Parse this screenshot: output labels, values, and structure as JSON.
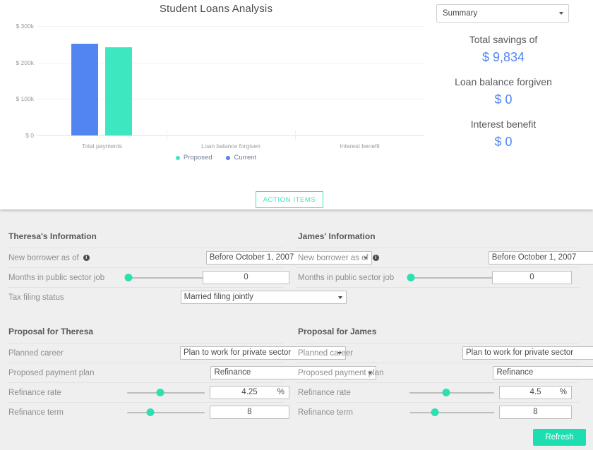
{
  "chart_data": {
    "type": "bar",
    "title": "Student Loans Analysis",
    "xlabel": "",
    "ylabel": "",
    "categories": [
      "Total payments",
      "Loan balance forgiven",
      "Interest benefit"
    ],
    "series": [
      {
        "name": "Proposed",
        "color": "#3de8c0",
        "values": [
          241000,
          0,
          0
        ]
      },
      {
        "name": "Current",
        "color": "#5285f2",
        "values": [
          251000,
          0,
          0
        ]
      }
    ],
    "ylim": [
      0,
      300000
    ],
    "yticks": [
      0,
      100000,
      200000,
      300000
    ],
    "ytick_labels": [
      "$ 0",
      "$ 100k",
      "$ 200k",
      "$ 300k"
    ],
    "grid": true,
    "legend_position": "bottom"
  },
  "summary": {
    "select_value": "Summary",
    "items": [
      {
        "label": "Total savings of",
        "value": "$ 9,834"
      },
      {
        "label": "Loan balance forgiven",
        "value": "$ 0"
      },
      {
        "label": "Interest benefit",
        "value": "$ 0"
      }
    ]
  },
  "action_items_label": "ACTION ITEMS",
  "refresh_label": "Refresh",
  "left": {
    "info_heading": "Theresa's Information",
    "proposal_heading": "Proposal for Theresa",
    "new_borrower_label": "New borrower as of",
    "new_borrower_value": "Before October 1, 2007",
    "months_label": "Months in public sector job",
    "months_value": "0",
    "months_slider_pct": 2,
    "tax_label": "Tax filing status",
    "tax_value": "Married filing jointly",
    "career_label": "Planned career",
    "career_value": "Plan to work for private sector",
    "plan_label": "Proposed payment plan",
    "plan_value": "Refinance",
    "rate_label": "Refinance rate",
    "rate_value": "4.25",
    "rate_unit": "%",
    "rate_slider_pct": 43,
    "term_label": "Refinance term",
    "term_value": "8",
    "term_slider_pct": 30
  },
  "right": {
    "info_heading": "James' Information",
    "proposal_heading": "Proposal for James",
    "new_borrower_label": "New borrower as of",
    "new_borrower_value": "Before October 1, 2007",
    "months_label": "Months in public sector job",
    "months_value": "0",
    "months_slider_pct": 2,
    "career_label": "Planned career",
    "career_value": "Plan to work for private sector",
    "plan_label": "Proposed payment plan",
    "plan_value": "Refinance",
    "rate_label": "Refinance rate",
    "rate_value": "4.5",
    "rate_unit": "%",
    "rate_slider_pct": 43,
    "term_label": "Refinance term",
    "term_value": "8",
    "term_slider_pct": 30
  },
  "colors": {
    "accent_green": "#3de8c0",
    "accent_blue": "#5285f2",
    "button_green": "#1ddeb0"
  }
}
